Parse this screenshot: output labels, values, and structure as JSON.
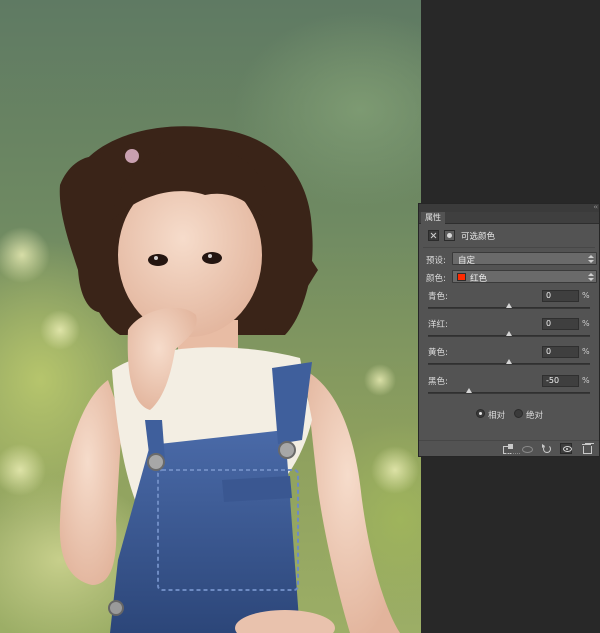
{
  "panel": {
    "collapse_glyph": "‹‹",
    "tab_label": "属性",
    "header_title": "可选颜色",
    "preset": {
      "label": "预设:",
      "value": "自定"
    },
    "colors": {
      "label": "颜色:",
      "value": "红色",
      "swatch_color": "#ff2a00"
    },
    "sliders": [
      {
        "label": "青色:",
        "value": "0",
        "unit": "%",
        "level_percent": 0
      },
      {
        "label": "洋红:",
        "value": "0",
        "unit": "%",
        "level_percent": 0
      },
      {
        "label": "黄色:",
        "value": "0",
        "unit": "%",
        "level_percent": 0
      },
      {
        "label": "黑色:",
        "value": "-50",
        "unit": "%",
        "level_percent": -50
      }
    ],
    "method": {
      "relative_label": "相对",
      "absolute_label": "绝对",
      "selected": "relative"
    },
    "footer_icons": [
      "clip-to-layer-icon",
      "view-previous-icon",
      "reset-icon",
      "visibility-eye-icon",
      "trash-icon"
    ]
  },
  "colors": {
    "panel_bg": "#535353",
    "workspace_bg": "#282828",
    "accent_red": "#ff2a00"
  }
}
